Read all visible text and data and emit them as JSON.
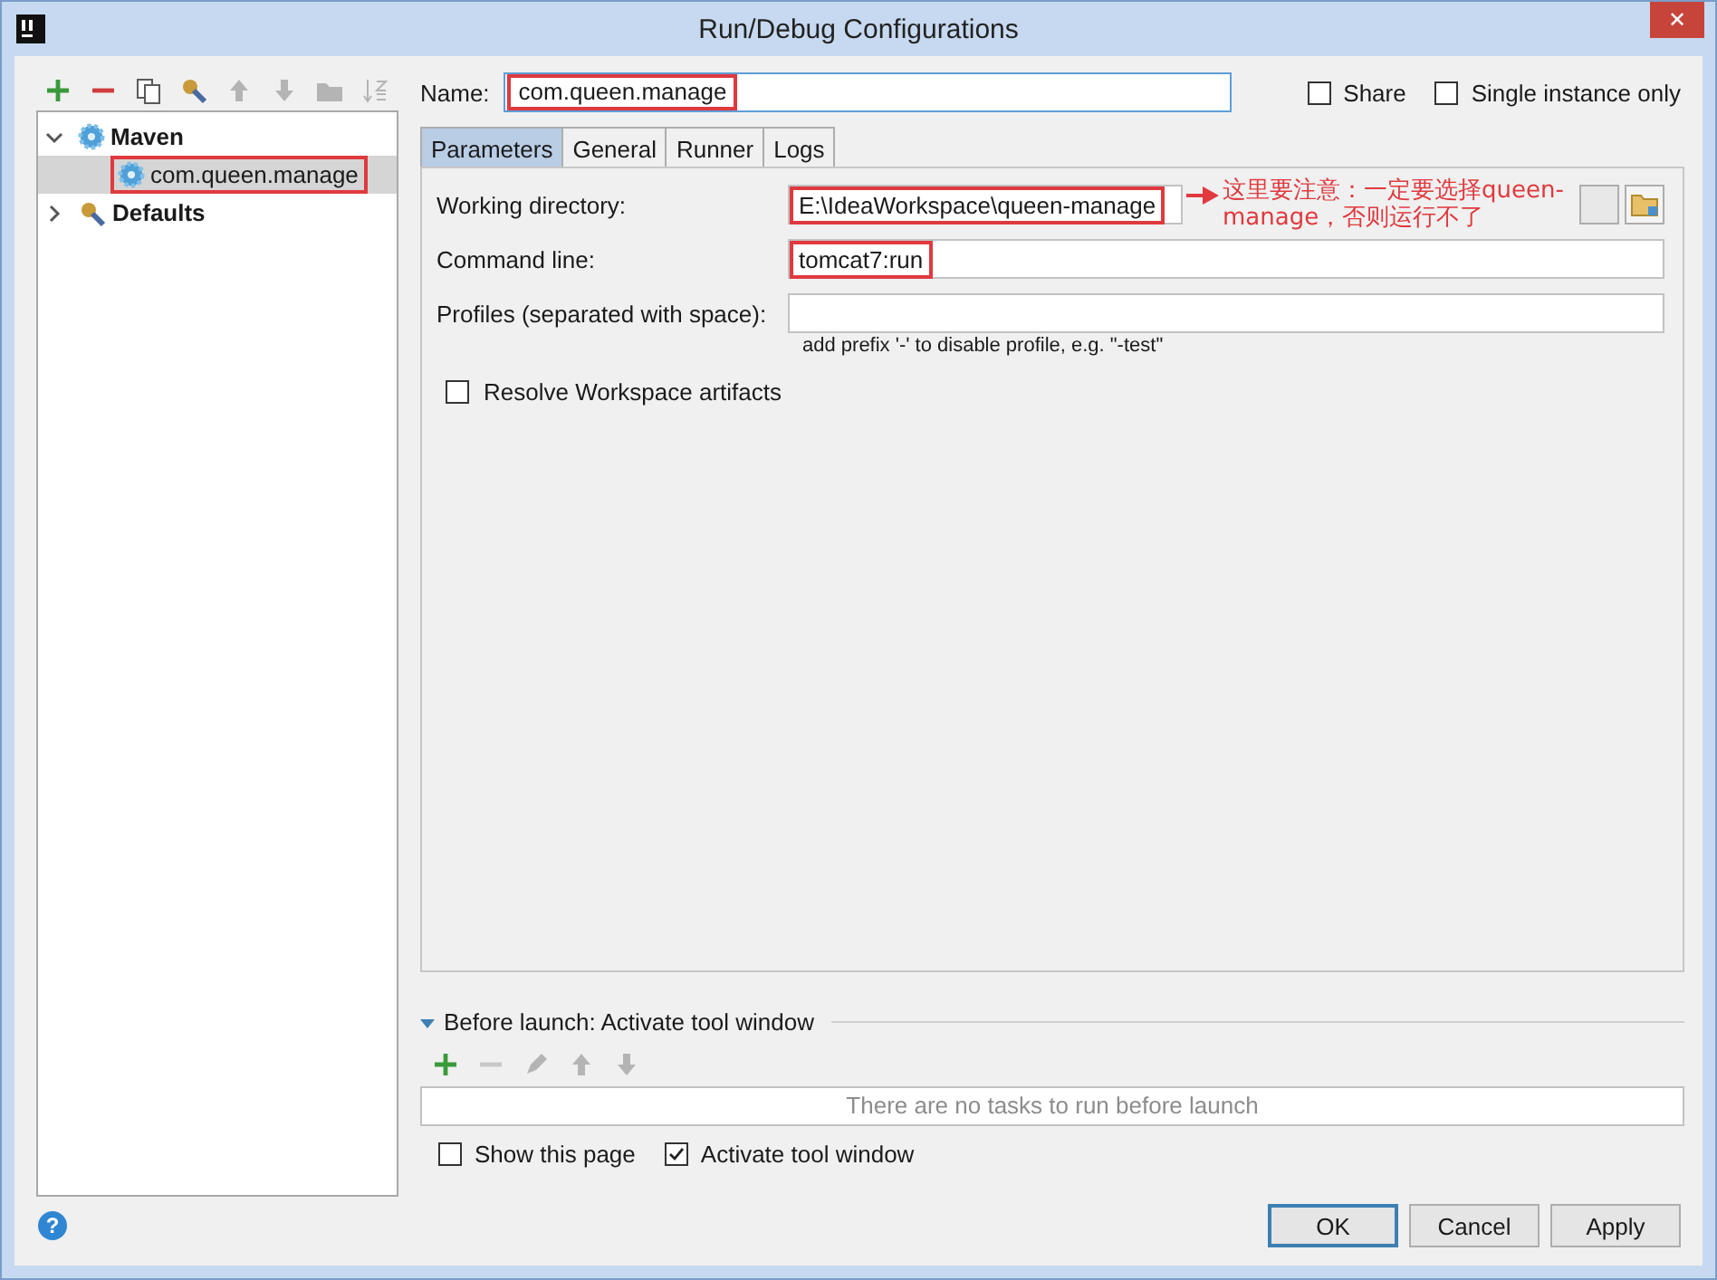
{
  "window": {
    "title": "Run/Debug Configurations",
    "close": "✕"
  },
  "toolbar": [
    {
      "kind": "add",
      "disabled": false
    },
    {
      "kind": "remove",
      "disabled": false
    },
    {
      "kind": "copy",
      "disabled": false
    },
    {
      "kind": "edit-defaults",
      "disabled": false
    },
    {
      "kind": "up",
      "disabled": true
    },
    {
      "kind": "down",
      "disabled": true
    },
    {
      "kind": "folder",
      "disabled": true
    },
    {
      "kind": "sort",
      "disabled": true
    }
  ],
  "tree": [
    {
      "label": "Maven",
      "expanded": true,
      "children": [
        {
          "label": "com.queen.manage",
          "selected": true,
          "highlighted": true
        }
      ]
    },
    {
      "label": "Defaults",
      "expanded": false
    }
  ],
  "name": {
    "label": "Name:",
    "value": "com.queen.manage",
    "highlighted": true
  },
  "options": [
    {
      "label": "Share",
      "checked": false
    },
    {
      "label": "Single instance only",
      "checked": false
    }
  ],
  "tabs": [
    {
      "label": "Parameters",
      "selected": true
    },
    {
      "label": "General",
      "selected": false
    },
    {
      "label": "Runner",
      "selected": false
    },
    {
      "label": "Logs",
      "selected": false
    }
  ],
  "fields": [
    {
      "label": "Working directory:",
      "value": "E:\\IdeaWorkspace\\queen-manage",
      "highlighted": true,
      "browse": true
    },
    {
      "label": "Command line:",
      "value": "tomcat7:run",
      "highlighted": true
    },
    {
      "label": "Profiles (separated with space):",
      "hint": "add prefix '-' to disable profile, e.g. \"-test\""
    }
  ],
  "annotation": {
    "text": "这里要注意：一定要选择queen-manage，否则运行不了"
  },
  "resolve": {
    "label": "Resolve Workspace artifacts",
    "checked": false
  },
  "before_launch": {
    "title": "Before launch: Activate tool window",
    "expanded": true,
    "toolbar": [
      {
        "kind": "add",
        "disabled": false
      },
      {
        "kind": "remove",
        "disabled": true
      },
      {
        "kind": "edit",
        "disabled": true
      },
      {
        "kind": "up",
        "disabled": true
      },
      {
        "kind": "down",
        "disabled": true
      }
    ],
    "empty_text": "There are no tasks to run before launch",
    "options": [
      {
        "label": "Show this page",
        "checked": false
      },
      {
        "label": "Activate tool window",
        "checked": true
      }
    ]
  },
  "help": "?",
  "buttons": [
    {
      "label": "OK",
      "default": true
    },
    {
      "label": "Cancel",
      "default": false
    },
    {
      "label": "Apply",
      "default": false
    }
  ]
}
